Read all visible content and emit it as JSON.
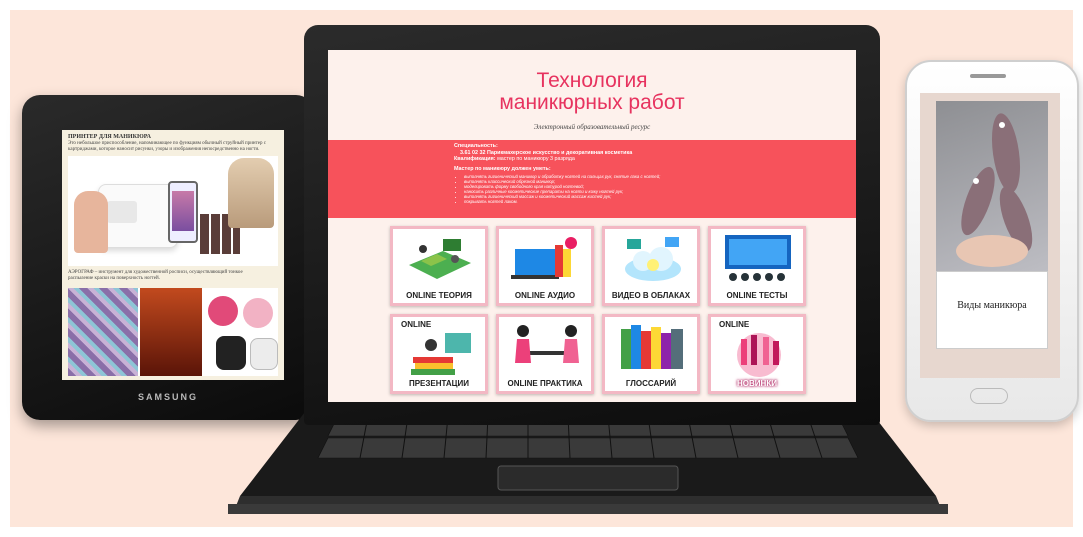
{
  "tablet": {
    "brand": "SAMSUNG",
    "section1_title": "ПРИНТЕР ДЛЯ МАНИКЮРА",
    "section1_text": "Это небольшое приспособление, напоминающее по функциям обычный струйный принтер с картриджами, которое наносит рисунки, узоры и изображения непосредственно на ногти.",
    "section2_text": "АЭРОГРАФ – инструмент для художественной росписи, осуществляющий тонкое распыление краски на поверхность ногтей."
  },
  "laptop": {
    "title_line1": "Технология",
    "title_line2": "маникюрных  работ",
    "subtitle": "Электронный образовательный ресурс",
    "spec_label": "Специальность:",
    "spec_value": "3.61 02 32   Парикмахерское искусство и    декоративная косметика",
    "qual_label": "Квалификация:",
    "qual_value": "мастер по маникюру 3 разряда",
    "skills_head": "Мастер по маникюру должен уметь:",
    "skills": [
      "выполнять гигиенический маникюр и обработку ногтей на пальцах рук, снятие лака с ногтей;",
      "выполнять классический обрезной маникюр;",
      "моделировать  форму свободного края натурой ногтевой;",
      "наносить различные косметические препараты на ногти и кожу ногтей рук;",
      "выполнять гигиенический массаж и косметический массаж кистей рук;",
      "покрывать ногтей лаком."
    ],
    "tiles": [
      {
        "top": "",
        "label": "ONLINE  ТЕОРИЯ"
      },
      {
        "top": "",
        "label": "ONLINE  АУДИО"
      },
      {
        "top": "",
        "label": "ВИДЕО В ОБЛАКАХ"
      },
      {
        "top": "",
        "label": "ONLINE  ТЕСТЫ"
      },
      {
        "top": "ONLINE",
        "label": "ПРЕЗЕНТАЦИИ"
      },
      {
        "top": "",
        "label": "ONLINE ПРАКТИКА"
      },
      {
        "top": "",
        "label": "ГЛОССАРИЙ"
      },
      {
        "top": "ONLINE",
        "label": "НОВИНКИ"
      }
    ]
  },
  "phone": {
    "label": "Виды маникюра"
  },
  "colors": {
    "background": "#fde6da",
    "title": "#e7335f",
    "band": "#f7525b",
    "tile_border": "#f3b8c4"
  }
}
